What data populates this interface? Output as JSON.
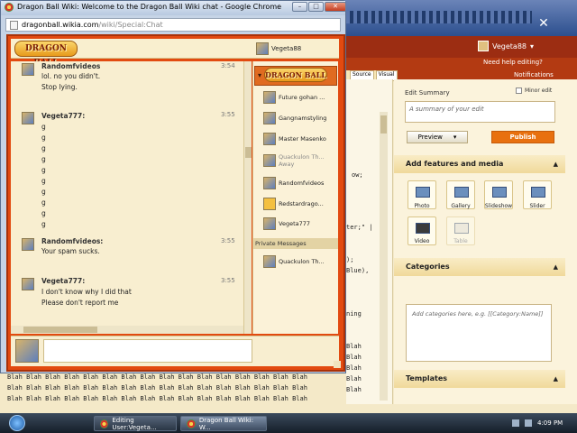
{
  "browser": {
    "window_title": "Dragon Ball Wiki: Welcome to the Dragon Ball Wiki chat - Google Chrome",
    "url_host": "dragonball.wikia.com",
    "url_path": "/wiki/Special:Chat"
  },
  "chat": {
    "logo_text": "DRAGON BALL",
    "current_user": "Vegeta88",
    "messages": [
      {
        "user": "Randomfvideos",
        "time": "3:54",
        "lines": [
          "lol. no you didn't.",
          "Stop lying."
        ]
      },
      {
        "user": "Vegeta777:",
        "time": "3:55",
        "lines": [
          "g",
          "g",
          "g",
          "g",
          "g",
          "g",
          "g",
          "g",
          "g",
          "g"
        ]
      },
      {
        "user": "Randomfvideos:",
        "time": "3:55",
        "lines": [
          "Your spam sucks."
        ]
      },
      {
        "user": "Vegeta777:",
        "time": "3:55",
        "lines": [
          "I don't know why I did that",
          "Please don't report me"
        ]
      }
    ],
    "users": [
      {
        "name": "Future gohan ...",
        "status": ""
      },
      {
        "name": "Gangnamstyling",
        "status": ""
      },
      {
        "name": "Master Masenko",
        "status": ""
      },
      {
        "name": "Quackulon Th...",
        "status": "Away"
      },
      {
        "name": "Randomfvideos",
        "status": ""
      },
      {
        "name": "Redstardrago...",
        "status": ""
      },
      {
        "name": "Vegeta777",
        "status": ""
      }
    ],
    "private_messages_label": "Private Messages",
    "private_messages": [
      {
        "name": "Quackulon Th..."
      }
    ]
  },
  "editor": {
    "user": "Vegeta88",
    "help_link": "Need help editing?",
    "notifications_link": "Notifications",
    "mode_tabs": [
      "Source",
      "Visual"
    ],
    "edit_summary_label": "Edit Summary",
    "minor_edit_label": "Minor edit",
    "summary_placeholder": "A summary of your edit",
    "preview_label": "Preview",
    "publish_label": "Publish",
    "features_heading": "Add features and media",
    "tools": [
      {
        "label": "Photo",
        "icon": "photo-icon"
      },
      {
        "label": "Gallery",
        "icon": "gallery-icon"
      },
      {
        "label": "Slideshow",
        "icon": "slideshow-icon"
      },
      {
        "label": "Slider",
        "icon": "slider-icon"
      },
      {
        "label": "Video",
        "icon": "video-icon"
      },
      {
        "label": "Table",
        "icon": "table-icon"
      }
    ],
    "categories_heading": "Categories",
    "categories_placeholder": "Add categories here, e.g. [[Category:Name]]",
    "templates_heading": "Templates",
    "code_fragments": [
      "ow;",
      "ter;\" |",
      ");",
      "Blue),",
      "ning",
      "Blah",
      "Blah",
      "Blah",
      "Blah",
      "Blah"
    ],
    "blah_text": "Blah Blah Blah Blah Blah Blah Blah Blah Blah Blah Blah Blah Blah Blah Blah Blah"
  },
  "taskbar": {
    "tasks": [
      "Editing User:Vegeta...",
      "Dragon Ball Wiki: W..."
    ],
    "clock": "4:09 PM"
  }
}
